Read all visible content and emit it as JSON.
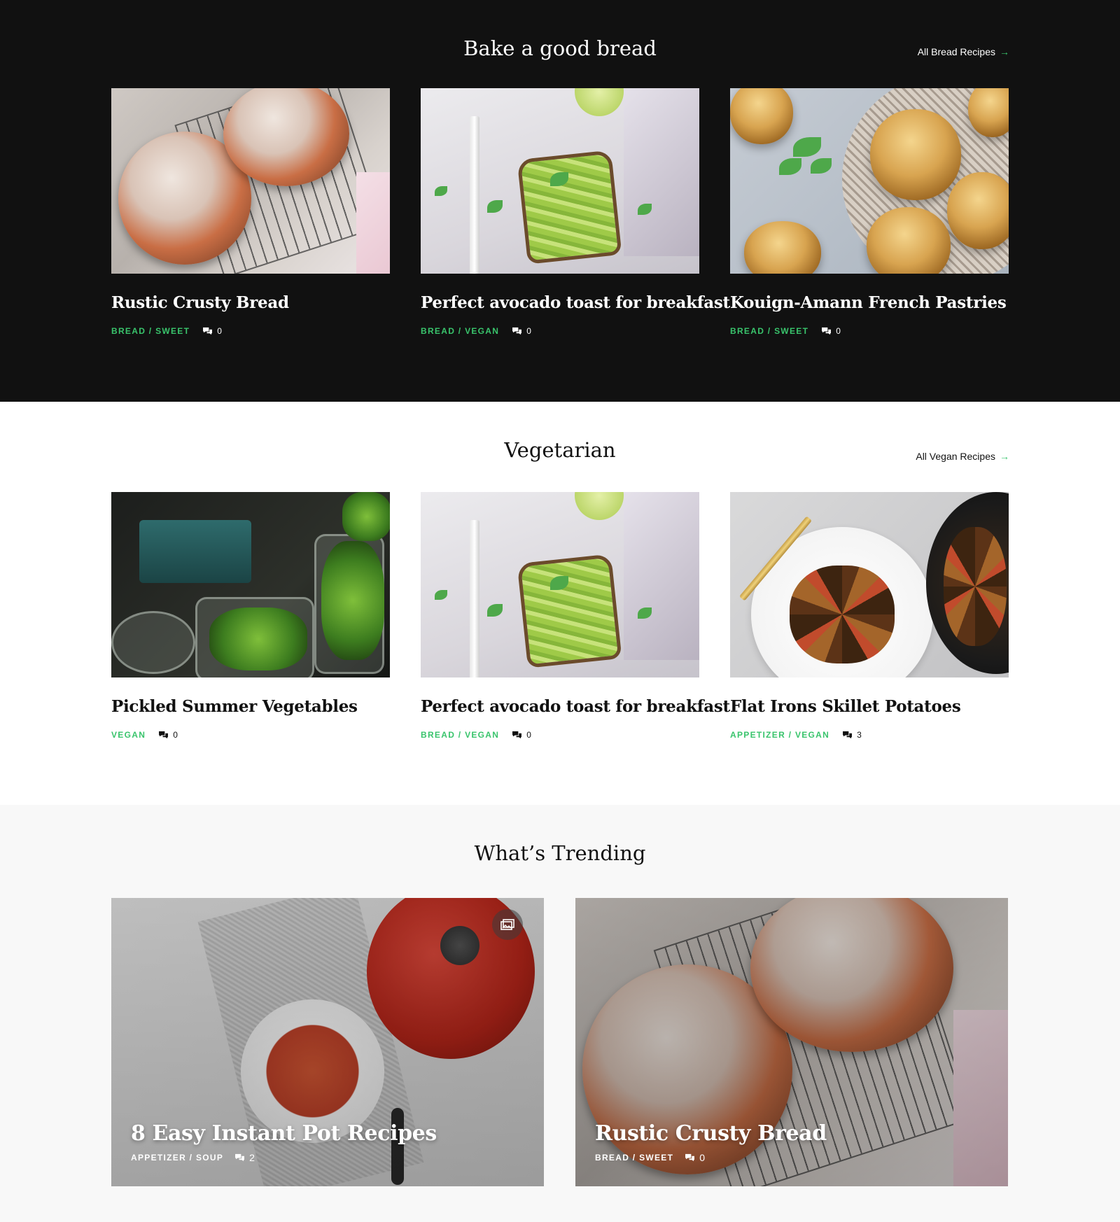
{
  "bread_section": {
    "title": "Bake a good bread",
    "link_label": "All Bread Recipes",
    "cards": [
      {
        "title": "Rustic Crusty Bread",
        "categories": "BREAD / SWEET",
        "comments": "0"
      },
      {
        "title": "Perfect avocado toast for breakfast",
        "categories": "BREAD / VEGAN",
        "comments": "0"
      },
      {
        "title": "Kouign-Amann French Pastries",
        "categories": "BREAD / SWEET",
        "comments": "0"
      }
    ]
  },
  "vegan_section": {
    "title": "Vegetarian",
    "link_label": "All Vegan Recipes",
    "cards": [
      {
        "title": "Pickled Summer Vegetables",
        "categories": "VEGAN",
        "comments": "0"
      },
      {
        "title": "Perfect avocado toast for breakfast",
        "categories": "BREAD / VEGAN",
        "comments": "0"
      },
      {
        "title": "Flat Irons Skillet Potatoes",
        "categories": "APPETIZER / VEGAN",
        "comments": "3"
      }
    ]
  },
  "trending_section": {
    "title": "What’s Trending",
    "cards": [
      {
        "title": "8 Easy Instant Pot Recipes",
        "categories": "APPETIZER / SOUP",
        "comments": "2"
      },
      {
        "title": "Rustic Crusty Bread",
        "categories": "BREAD / SWEET",
        "comments": "0"
      }
    ]
  },
  "icons": {
    "arrow": "arrow-right-icon",
    "comments": "comments-icon",
    "gallery": "gallery-icon"
  },
  "colors": {
    "accent": "#39c46c",
    "dark_bg": "#111111",
    "light_bg": "#ffffff",
    "gray_bg": "#f8f8f8"
  }
}
